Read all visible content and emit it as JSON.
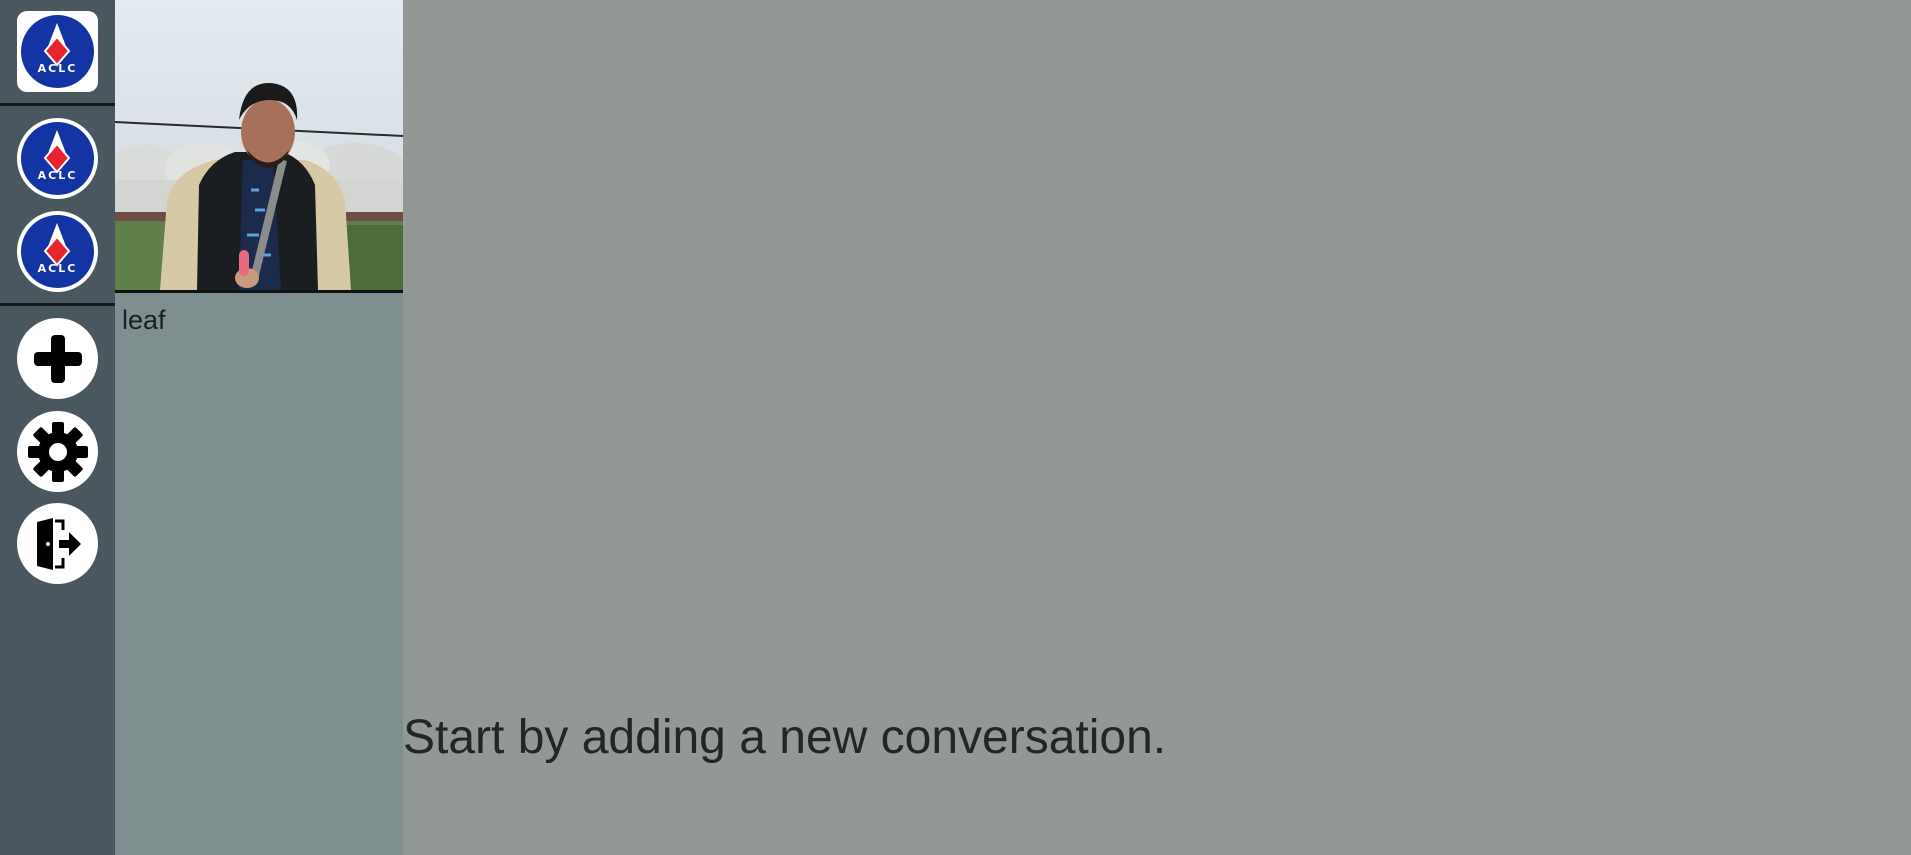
{
  "rail": {
    "home_logo": {
      "icon": "aclc-logo-icon",
      "text": "ACLC"
    },
    "groups": [
      {
        "icon": "aclc-logo-icon",
        "text": "ACLC"
      },
      {
        "icon": "aclc-logo-icon",
        "text": "ACLC"
      }
    ],
    "actions": [
      {
        "icon": "plus-icon"
      },
      {
        "icon": "gear-icon"
      },
      {
        "icon": "logout-door-icon"
      }
    ]
  },
  "conversations": [
    {
      "name": "leaf",
      "avatar": "profile-photo"
    }
  ],
  "main": {
    "empty_message": "Start by adding a new conversation."
  },
  "colors": {
    "rail_bg": "#4b575e",
    "panel_bg": "#7f8f8f",
    "main_bg": "#929893",
    "logo_blue": "#1434a4",
    "logo_red": "#e8232d"
  }
}
